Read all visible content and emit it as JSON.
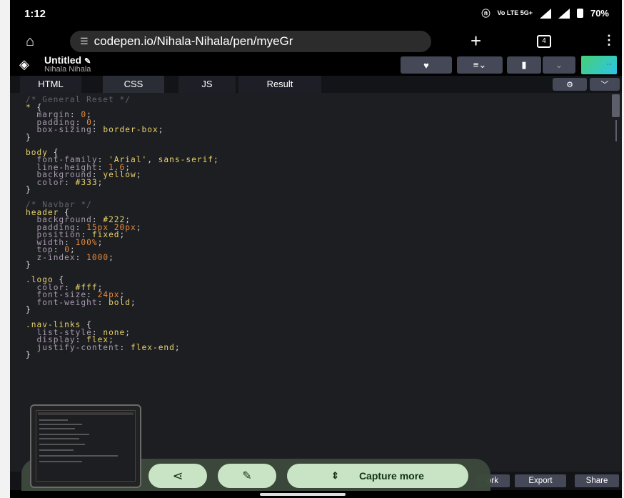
{
  "status": {
    "time": "1:12",
    "battery": "70%",
    "network": "Vo LTE 5G+"
  },
  "browser": {
    "url": "codepen.io/Nihala-Nihala/pen/myeGr",
    "tab_count": "4"
  },
  "pen": {
    "title": "Untitled",
    "author": "Nihala Nihala"
  },
  "tabs": [
    "HTML",
    "CSS",
    "JS",
    "Result"
  ],
  "active_tab": "CSS",
  "footer": {
    "fork": "ork",
    "export": "Export",
    "share": "Share"
  },
  "capture": {
    "capture_more": "Capture more"
  },
  "colors": {
    "editor_bg": "#1d1e22",
    "button_bg": "#444857",
    "capture_btn": "#c9e4c5"
  },
  "icons": [
    "home-icon",
    "tune-icon",
    "plus-icon",
    "tabs-icon",
    "menu-icon",
    "codepen-logo-icon",
    "pencil-icon",
    "heart-icon",
    "layout-icon",
    "bookmark-icon",
    "chevron-down-icon",
    "gear-icon",
    "share-icon",
    "edit-icon",
    "expand-icon"
  ]
}
